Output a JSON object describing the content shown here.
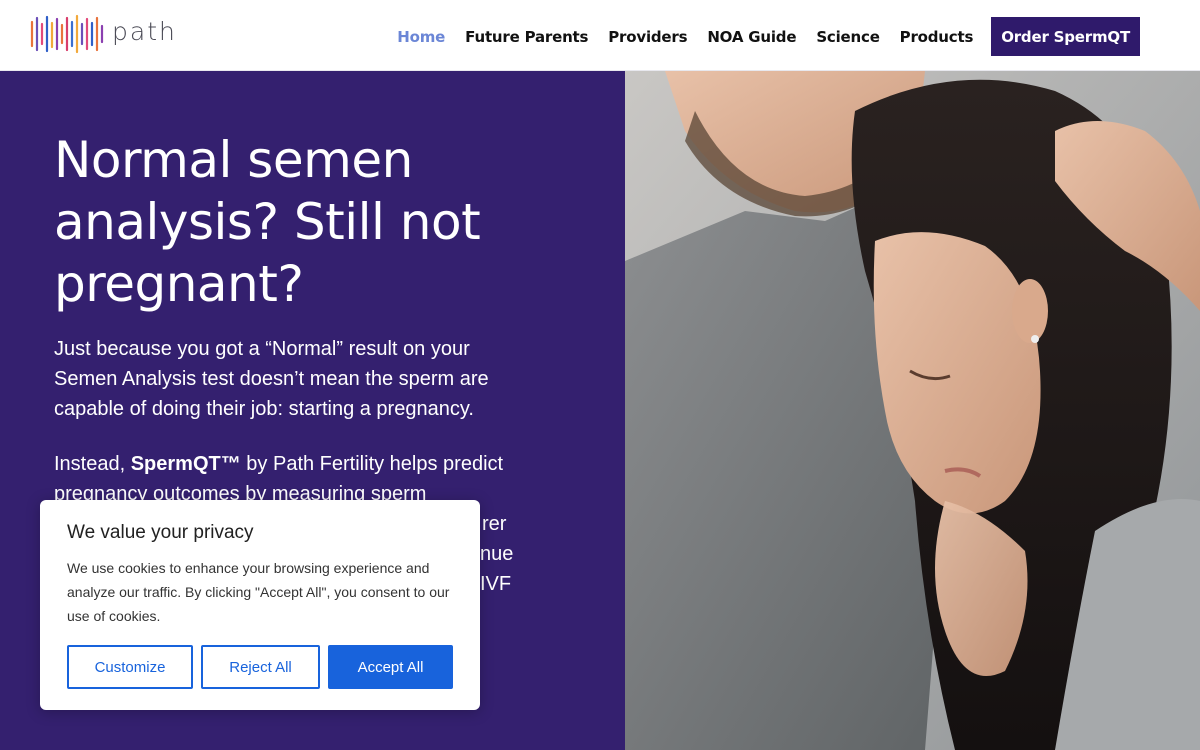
{
  "header": {
    "logo_text": "path",
    "nav": [
      {
        "label": "Home",
        "active": true
      },
      {
        "label": "Future Parents",
        "active": false
      },
      {
        "label": "Providers",
        "active": false
      },
      {
        "label": "NOA Guide",
        "active": false
      },
      {
        "label": "Science",
        "active": false
      },
      {
        "label": "Products",
        "active": false
      }
    ],
    "cta_label": "Order SpermQT"
  },
  "hero": {
    "title": "Normal semen analysis? Still not pregnant?",
    "paragraph1": "Just because you got a “Normal” result on your Semen Analysis test doesn’t mean the sperm are capable of doing their job: starting a pregnancy.",
    "paragraph2_prefix": "Instead, ",
    "paragraph2_brand": "SpermQT™",
    "paragraph2_suffix": " by Path Fertility helps predict pregnancy outcomes by measuring sperm",
    "paragraph2_obscured": [
      "rer",
      "nue",
      "IVF"
    ],
    "image_alt": "couple embracing"
  },
  "cookie": {
    "title": "We value your privacy",
    "text": "We use cookies to enhance your browsing experience and analyze our traffic. By clicking \"Accept All\", you consent to our use of cookies.",
    "customize_label": "Customize",
    "reject_label": "Reject All",
    "accept_label": "Accept All"
  },
  "colors": {
    "brand_purple": "#34206f",
    "cta_purple": "#2f1a6b",
    "nav_active": "#6b86d6",
    "cookie_blue": "#1863dc"
  }
}
